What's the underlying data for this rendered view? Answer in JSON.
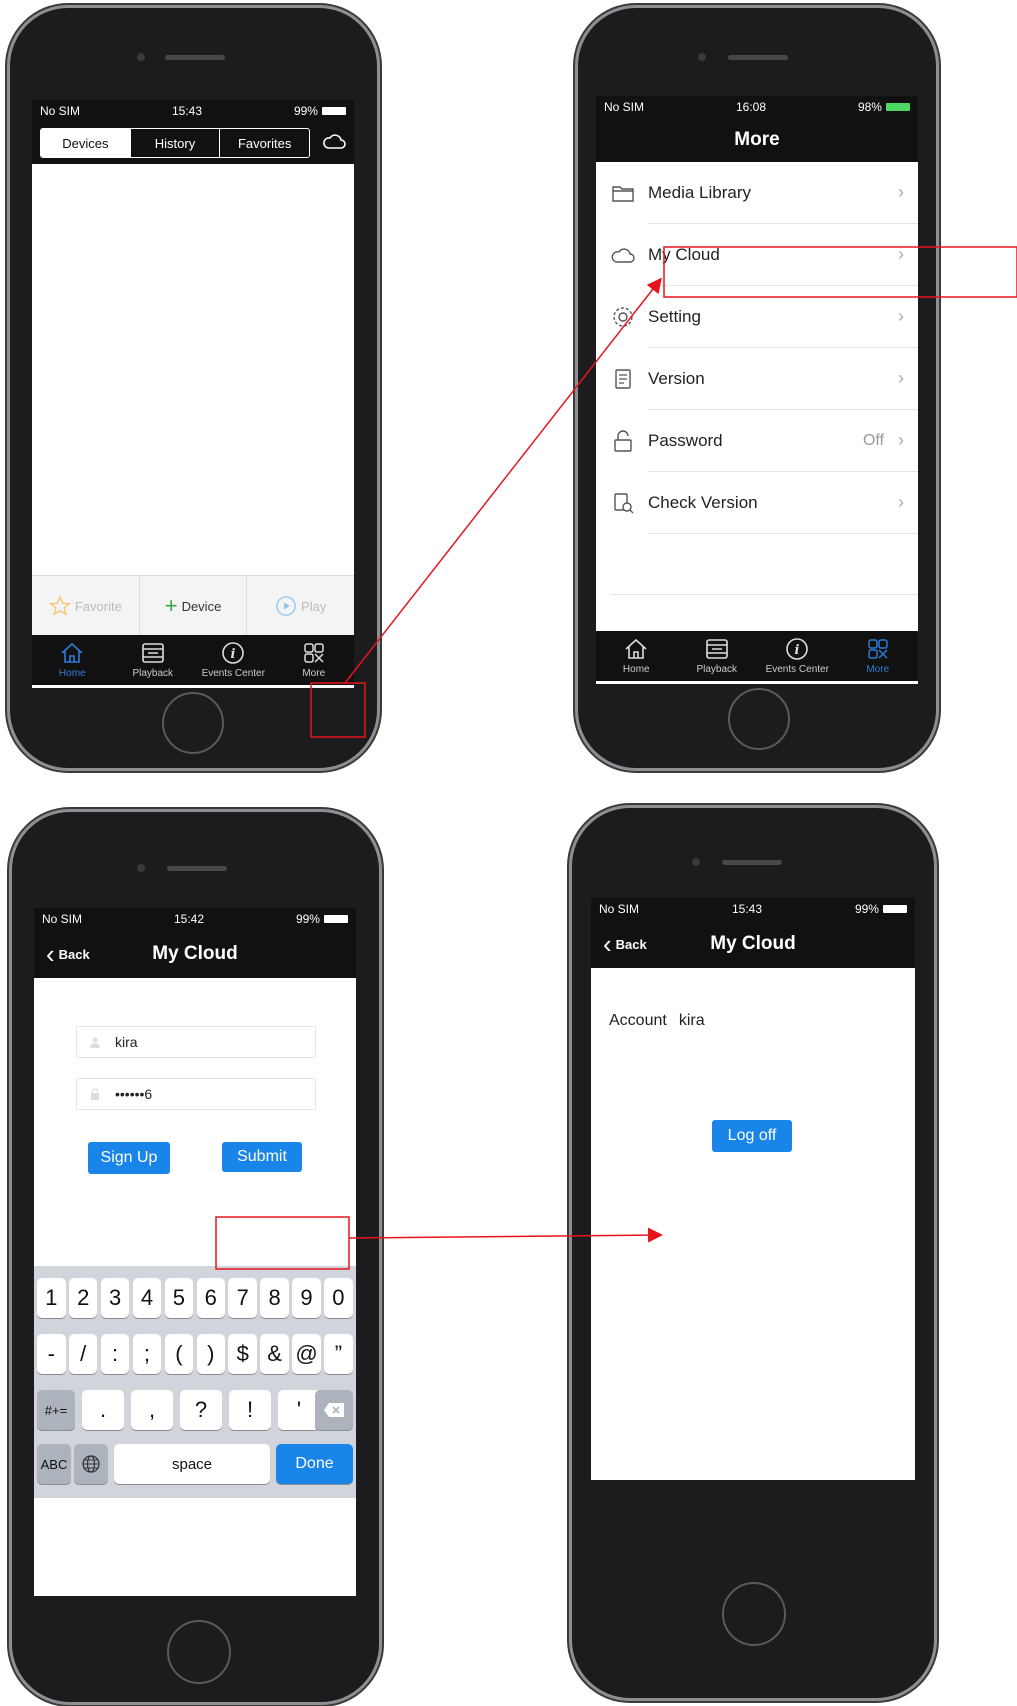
{
  "phone1": {
    "status": {
      "carrier": "No SIM",
      "time": "15:43",
      "battery": "99%"
    },
    "segments": [
      "Devices",
      "History",
      "Favorites"
    ],
    "toolbar": {
      "favorite": "Favorite",
      "device": "Device",
      "play": "Play"
    },
    "tabs": [
      "Home",
      "Playback",
      "Events Center",
      "More"
    ]
  },
  "phone2": {
    "status": {
      "carrier": "No SIM",
      "time": "16:08",
      "battery": "98%"
    },
    "title": "More",
    "menu": [
      {
        "label": "Media Library",
        "value": ""
      },
      {
        "label": "My Cloud",
        "value": ""
      },
      {
        "label": "Setting",
        "value": ""
      },
      {
        "label": "Version",
        "value": ""
      },
      {
        "label": "Password",
        "value": "Off"
      },
      {
        "label": "Check Version",
        "value": ""
      }
    ],
    "tabs": [
      "Home",
      "Playback",
      "Events Center",
      "More"
    ]
  },
  "phone3": {
    "status": {
      "carrier": "No SIM",
      "time": "15:42",
      "battery": "99%"
    },
    "back": "Back",
    "title": "My Cloud",
    "username": "kira",
    "password": "••••••6",
    "signup": "Sign Up",
    "submit": "Submit",
    "keyboard": {
      "row1": [
        "1",
        "2",
        "3",
        "4",
        "5",
        "6",
        "7",
        "8",
        "9",
        "0"
      ],
      "row2": [
        "-",
        "/",
        ":",
        ";",
        "(",
        ")",
        "$",
        "&",
        "@",
        "”"
      ],
      "row3": [
        ".",
        ",",
        "?",
        "!",
        "'"
      ],
      "symbols": "#+=",
      "abc": "ABC",
      "space": "space",
      "done": "Done"
    }
  },
  "phone4": {
    "status": {
      "carrier": "No SIM",
      "time": "15:43",
      "battery": "99%"
    },
    "back": "Back",
    "title": "My Cloud",
    "account_label": "Account",
    "account_value": "kira",
    "logoff": "Log off"
  },
  "colors": {
    "accent": "#1a85e8",
    "highlight": "#e8141c",
    "bar": "#111111",
    "active_tab": "#2e7bd6"
  }
}
